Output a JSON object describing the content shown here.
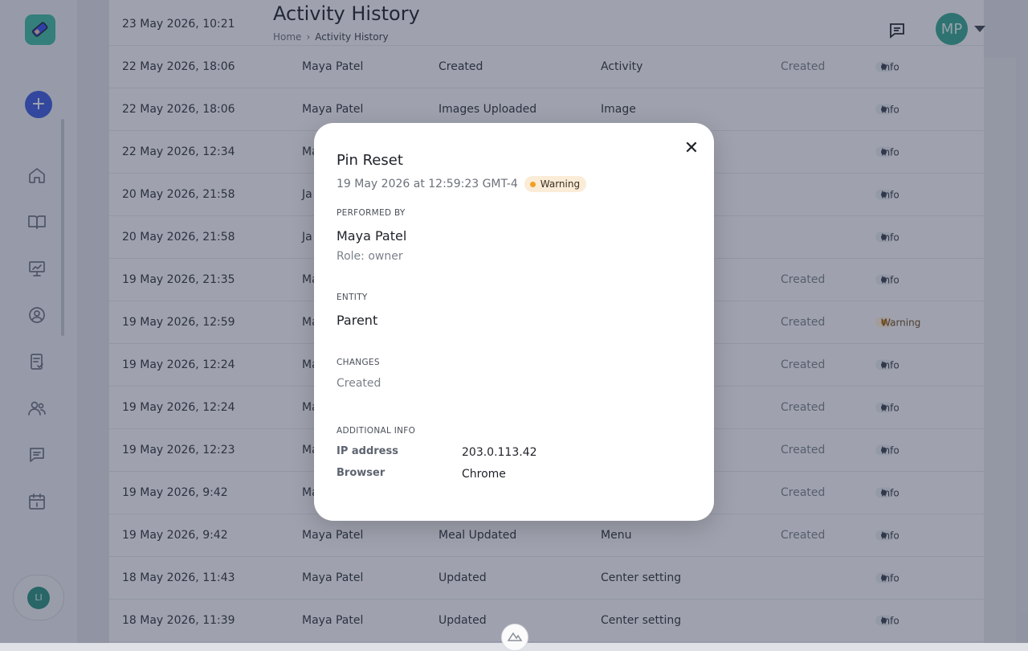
{
  "header": {
    "title": "Activity History",
    "breadcrumb_home": "Home",
    "breadcrumb_current": "Activity History",
    "avatar_initials": "MP"
  },
  "sidebar": {
    "items": [
      "home-icon",
      "book-icon",
      "presentation-icon",
      "user-circle-icon",
      "clipboard-check-icon",
      "users-icon",
      "chat-icon",
      "calendar-icon"
    ],
    "user_initials": "LI",
    "add_label": "+"
  },
  "rows": [
    {
      "date": "23 May 2026, 10:21",
      "user": "",
      "action": "",
      "entity": "",
      "changes": "",
      "level": ""
    },
    {
      "date": "22 May 2026, 18:06",
      "user": "Maya Patel",
      "action": "Created",
      "entity": "Activity",
      "changes": "Created",
      "level": "Info"
    },
    {
      "date": "22 May 2026, 18:06",
      "user": "Maya Patel",
      "action": "Images Uploaded",
      "entity": "Image",
      "changes": "",
      "level": "Info"
    },
    {
      "date": "22 May 2026, 12:34",
      "user": "Ma",
      "action": "",
      "entity": "",
      "changes": "",
      "level": "Info"
    },
    {
      "date": "20 May 2026, 21:58",
      "user": "Ja",
      "action": "",
      "entity": "",
      "changes": "",
      "level": "Info"
    },
    {
      "date": "20 May 2026, 21:58",
      "user": "Ja",
      "action": "",
      "entity": "",
      "changes": "",
      "level": "Info"
    },
    {
      "date": "19 May 2026, 21:35",
      "user": "Ma",
      "action": "",
      "entity": "",
      "changes": "Created",
      "level": "Info"
    },
    {
      "date": "19 May 2026, 12:59",
      "user": "Ma",
      "action": "",
      "entity": "",
      "changes": "Created",
      "level": "Warning"
    },
    {
      "date": "19 May 2026, 12:24",
      "user": "Ma",
      "action": "",
      "entity": "",
      "changes": "Created",
      "level": "Info"
    },
    {
      "date": "19 May 2026, 12:24",
      "user": "Ma",
      "action": "",
      "entity": "",
      "changes": "Created",
      "level": "Info"
    },
    {
      "date": "19 May 2026, 12:23",
      "user": "Ma",
      "action": "",
      "entity": "",
      "changes": "Created",
      "level": "Info"
    },
    {
      "date": "19 May 2026, 9:42",
      "user": "Ma",
      "action": "",
      "entity": "",
      "changes": "Created",
      "level": "Info"
    },
    {
      "date": "19 May 2026, 9:42",
      "user": "Maya Patel",
      "action": "Meal Updated",
      "entity": "Menu",
      "changes": "Created",
      "level": "Info"
    },
    {
      "date": "18 May 2026, 11:43",
      "user": "Maya Patel",
      "action": "Updated",
      "entity": "Center setting",
      "changes": "",
      "level": "Info"
    },
    {
      "date": "18 May 2026, 11:39",
      "user": "Maya Patel",
      "action": "Updated",
      "entity": "Center setting",
      "changes": "",
      "level": "Info"
    }
  ],
  "modal": {
    "title": "Pin Reset",
    "timestamp": "19 May 2026 at 12:59:23 GMT-4",
    "level": "Warning",
    "performed_by_label": "PERFORMED BY",
    "performed_by_name": "Maya Patel",
    "performed_by_role": "Role: owner",
    "entity_label": "ENTITY",
    "entity_value": "Parent",
    "changes_label": "CHANGES",
    "changes_value": "Created",
    "additional_label": "ADDITIONAL INFO",
    "ip_label": "IP address",
    "ip_value": "203.0.113.42",
    "browser_label": "Browser",
    "browser_value": "Chrome",
    "close_label": "✕"
  }
}
